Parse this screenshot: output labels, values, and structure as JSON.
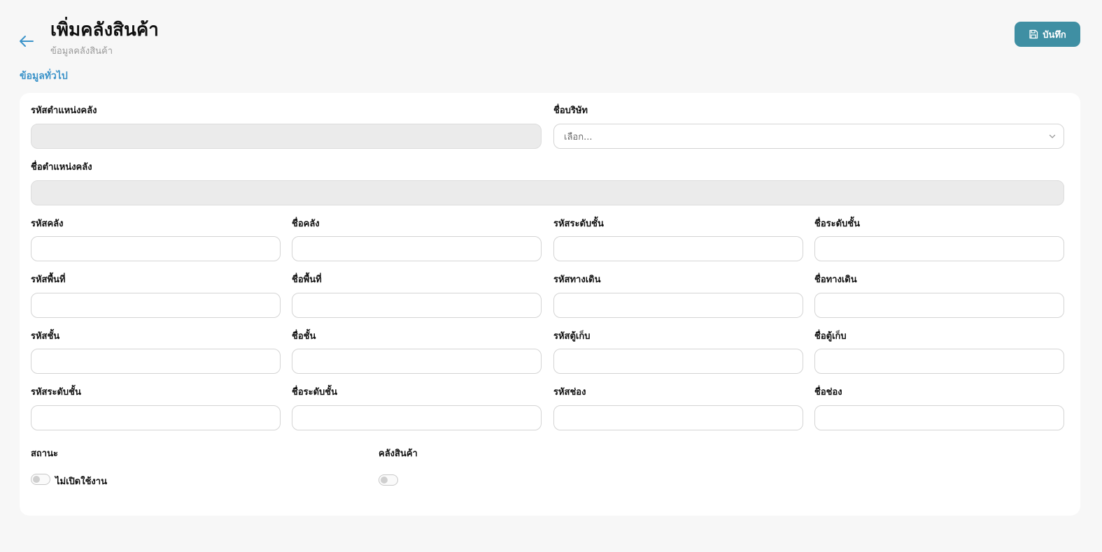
{
  "header": {
    "title": "เพิ่มคลังสินค้า",
    "subtitle": "ข้อมูลคลังสินค้า",
    "save_label": "บันทึก"
  },
  "section": {
    "general_label": "ข้อมูลทั่วไป"
  },
  "form": {
    "location_code_label": "รหัสตำแหน่งคลัง",
    "company_name_label": "ชื่อบริษัท",
    "company_placeholder": "เลือก...",
    "location_name_label": "ชื่อตำแหน่งคลัง",
    "warehouse_code_label": "รหัสคลัง",
    "warehouse_name_label": "ชื่อคลัง",
    "level_code_label": "รหัสระดับชั้น",
    "level_name_label": "ชื่อระดับชั้น",
    "area_code_label": "รหัสพื้นที่",
    "area_name_label": "ชื่อพื้นที่",
    "aisle_code_label": "รหัสทางเดิน",
    "aisle_name_label": "ชื่อทางเดิน",
    "floor_code_label": "รหัสชั้น",
    "floor_name_label": "ชื่อชั้น",
    "cabinet_code_label": "รหัสตู้เก็บ",
    "cabinet_name_label": "ชื่อตู้เก็บ",
    "level_code2_label": "รหัสระดับชั้น",
    "level_name2_label": "ชื่อระดับชั้น",
    "slot_code_label": "รหัสช่อง",
    "slot_name_label": "ชื่อช่อง",
    "status_label": "สถานะ",
    "status_value": "ไม่เปิดใช้งาน",
    "warehouse_toggle_label": "คลังสินค้า"
  },
  "colors": {
    "accent": "#3f8fa3",
    "link": "#3b93c9",
    "background": "#f7f7f7"
  },
  "icons": {
    "back": "arrow-left-icon",
    "save": "floppy-disk-icon",
    "dropdown": "chevron-down-icon"
  }
}
